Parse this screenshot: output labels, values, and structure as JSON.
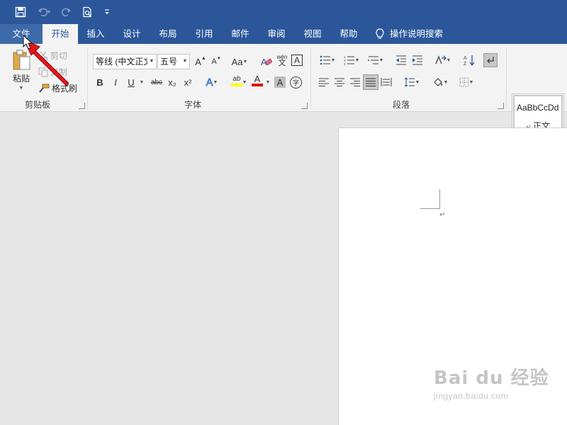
{
  "qat": {
    "save_icon": "save-icon",
    "undo_icon": "undo-icon",
    "redo_icon": "redo-icon",
    "print_preview_icon": "print-preview-icon",
    "customize_icon": "customize-qat-icon"
  },
  "tabs": [
    {
      "label": "文件",
      "state": "file"
    },
    {
      "label": "开始",
      "state": "active"
    },
    {
      "label": "插入",
      "state": "normal"
    },
    {
      "label": "设计",
      "state": "normal"
    },
    {
      "label": "布局",
      "state": "normal"
    },
    {
      "label": "引用",
      "state": "normal"
    },
    {
      "label": "邮件",
      "state": "normal"
    },
    {
      "label": "审阅",
      "state": "normal"
    },
    {
      "label": "视图",
      "state": "normal"
    },
    {
      "label": "帮助",
      "state": "normal"
    }
  ],
  "tell_me": {
    "label": "操作说明搜索",
    "icon": "lightbulb-icon"
  },
  "clipboard": {
    "paste_label": "粘贴",
    "cut_label": "剪切",
    "copy_label": "复制",
    "format_painter_label": "格式刷",
    "group_label": "剪贴板"
  },
  "font": {
    "font_name": "等线 (中文正文",
    "font_size": "五号",
    "grow_label": "A",
    "shrink_label": "A",
    "case_label": "Aa",
    "phonetic_label": "wén",
    "phonetic_char": "文",
    "border_char_label": "A",
    "bold": "B",
    "italic": "I",
    "underline": "U",
    "strikethrough": "abc",
    "subscript": "x₂",
    "superscript": "x²",
    "effects_label": "A",
    "highlight_label": "ab",
    "font_color_label": "A",
    "shading_label": "A",
    "enclose_label": "字",
    "group_label": "字体"
  },
  "paragraph": {
    "group_label": "段落",
    "sort_label": "A↓Z"
  },
  "styles": {
    "sample_text": "AaBbCcDd",
    "normal_label": "正文"
  },
  "document": {
    "para_mark": "↵"
  },
  "watermark": {
    "main": "Bai du 经验",
    "sub": "jingyan.baidu.com"
  },
  "colors": {
    "accent": "#2b579a",
    "highlight_yellow": "#ffff00",
    "font_red": "#e00000",
    "annotation_red": "#e8141b"
  }
}
